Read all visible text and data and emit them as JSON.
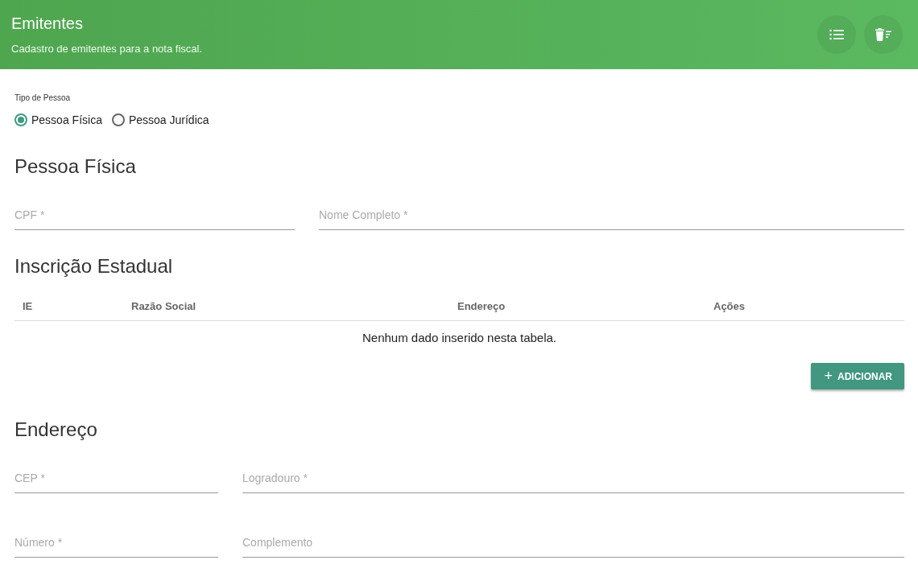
{
  "header": {
    "title": "Emitentes",
    "subtitle": "Cadastro de emitentes para a nota fiscal.",
    "actions": [
      {
        "kind": "list"
      },
      {
        "kind": "delete-list"
      }
    ]
  },
  "person_type": {
    "label": "Tipo de Pessoa",
    "options": [
      {
        "label": "Pessoa Física",
        "selected": true
      },
      {
        "label": "Pessoa Jurídica",
        "selected": false
      }
    ]
  },
  "sections": [
    {
      "kind": "fields",
      "title": "Pessoa Física",
      "rows": [
        [
          {
            "placeholder": "CPF *"
          },
          {
            "placeholder": "Nome Completo *"
          }
        ]
      ]
    },
    {
      "kind": "table",
      "title": "Inscrição Estadual",
      "columns": [
        "IE",
        "Razão Social",
        "Endereço",
        "Ações"
      ],
      "empty_text": "Nenhum dado inserido nesta tabela.",
      "button": {
        "icon": "+",
        "label": "ADICIONAR"
      }
    },
    {
      "kind": "fields",
      "title": "Endereço",
      "rows": [
        [
          {
            "placeholder": "CEP *"
          },
          {
            "placeholder": "Logradouro *"
          }
        ],
        [
          {
            "placeholder": "Número *"
          },
          {
            "placeholder": "Complemento"
          }
        ]
      ]
    }
  ]
}
